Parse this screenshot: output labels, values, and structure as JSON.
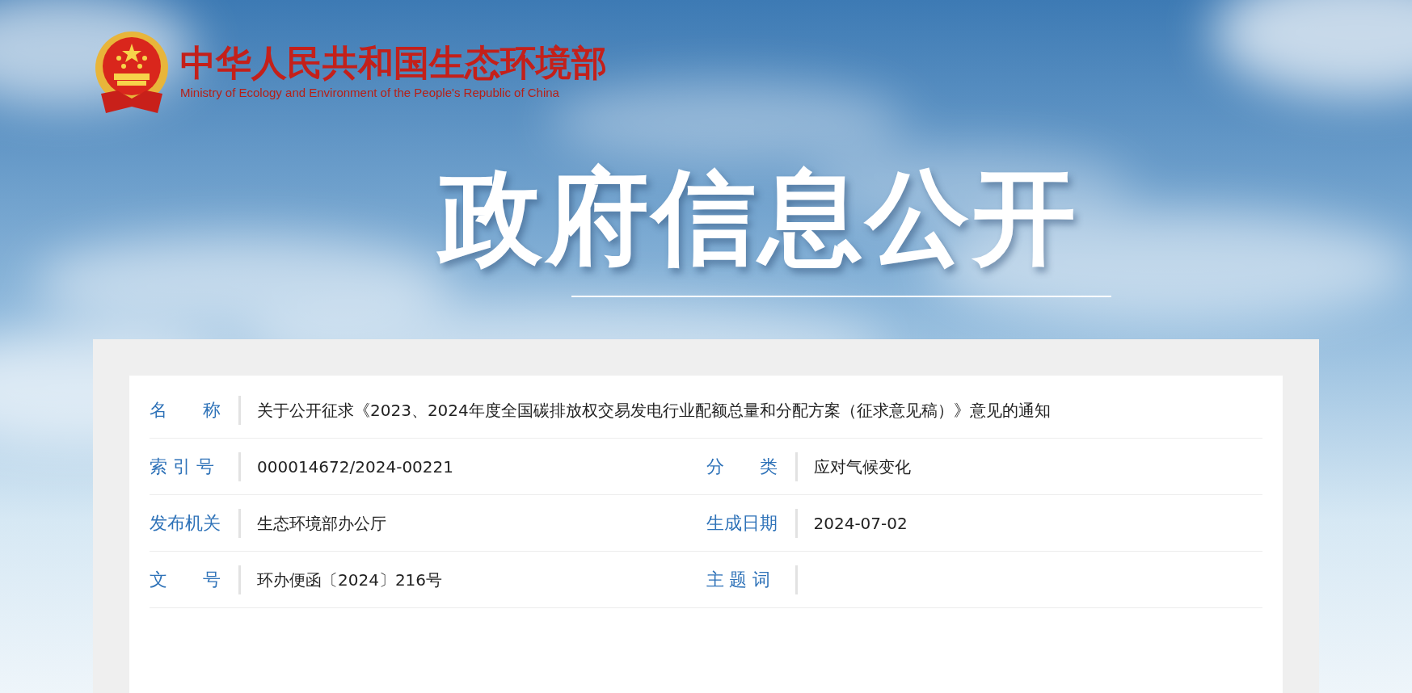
{
  "header": {
    "title": "中华人民共和国生态环境部",
    "subtitle": "Ministry of Ecology and Environment of the People's Republic of China"
  },
  "banner": {
    "title": "政府信息公开"
  },
  "info_table": {
    "rows": [
      [
        {
          "label": "名　　称",
          "value": "关于公开征求《2023、2024年度全国碳排放权交易发电行业配额总量和分配方案（征求意见稿）》意见的通知"
        }
      ],
      [
        {
          "label": "索 引 号",
          "value": "000014672/2024-00221"
        },
        {
          "label": "分　　类",
          "value": "应对气候变化"
        }
      ],
      [
        {
          "label": "发布机关",
          "value": "生态环境部办公厅"
        },
        {
          "label": "生成日期",
          "value": "2024-07-02"
        }
      ],
      [
        {
          "label": "文　　号",
          "value": "环办便函〔2024〕216号"
        },
        {
          "label": "主 题 词"
        }
      ]
    ]
  }
}
